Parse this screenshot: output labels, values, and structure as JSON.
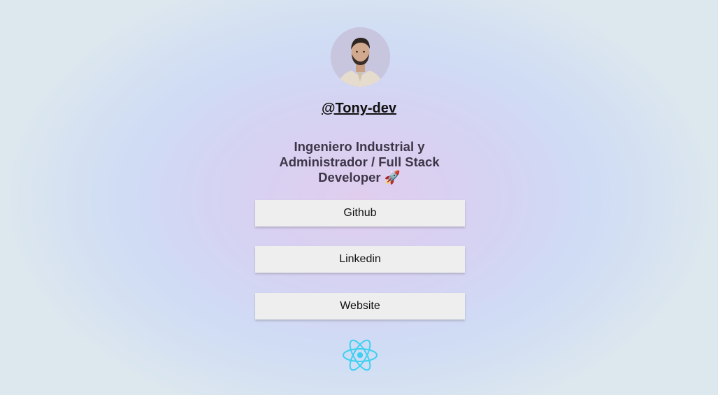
{
  "profile": {
    "handle": "@Tony-dev",
    "bio": "Ingeniero Industrial y Administrador / Full Stack Developer 🚀"
  },
  "links": [
    {
      "label": "Github"
    },
    {
      "label": "Linkedin"
    },
    {
      "label": "Website"
    }
  ],
  "footer": {
    "logo_icon": "react-logo-icon",
    "logo_color": "#3fd0f1"
  },
  "colors": {
    "button_bg": "#eeeeee",
    "bio_text": "#3d3648"
  }
}
